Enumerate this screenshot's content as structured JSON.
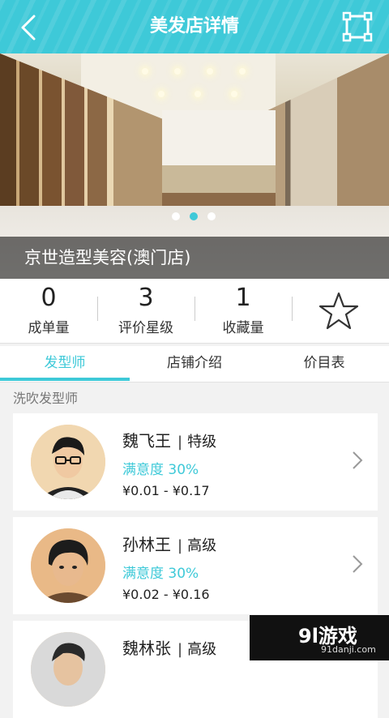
{
  "header": {
    "title": "美发店详情",
    "back_icon": "chevron-left-icon",
    "expand_icon": "fullscreen-icon"
  },
  "banner": {
    "shop_name": "京世造型美容(澳门店)",
    "slides": 3,
    "active_slide": 2
  },
  "stats": {
    "orders": {
      "value": "0",
      "label": "成单量"
    },
    "rating": {
      "value": "3",
      "label": "评价星级"
    },
    "favorites": {
      "value": "1",
      "label": "收藏量"
    },
    "favorite_icon": "star-outline-icon"
  },
  "tabs": [
    {
      "label": "发型师",
      "active": true
    },
    {
      "label": "店铺介绍",
      "active": false
    },
    {
      "label": "价目表",
      "active": false
    }
  ],
  "section": {
    "label": "洗吹发型师"
  },
  "stylists": [
    {
      "name": "魏飞王",
      "level": "特级",
      "satisfaction": "满意度 30%",
      "price": "¥0.01 - ¥0.17"
    },
    {
      "name": "孙林王",
      "level": "高级",
      "satisfaction": "满意度 30%",
      "price": "¥0.02 - ¥0.16"
    },
    {
      "name": "魏林张",
      "level": "高级",
      "satisfaction": "",
      "price": ""
    }
  ],
  "watermark": {
    "brand": "9l游戏",
    "url": "91danji.com"
  },
  "colors": {
    "accent": "#3ec9d8",
    "header": "#3ec9d8"
  }
}
